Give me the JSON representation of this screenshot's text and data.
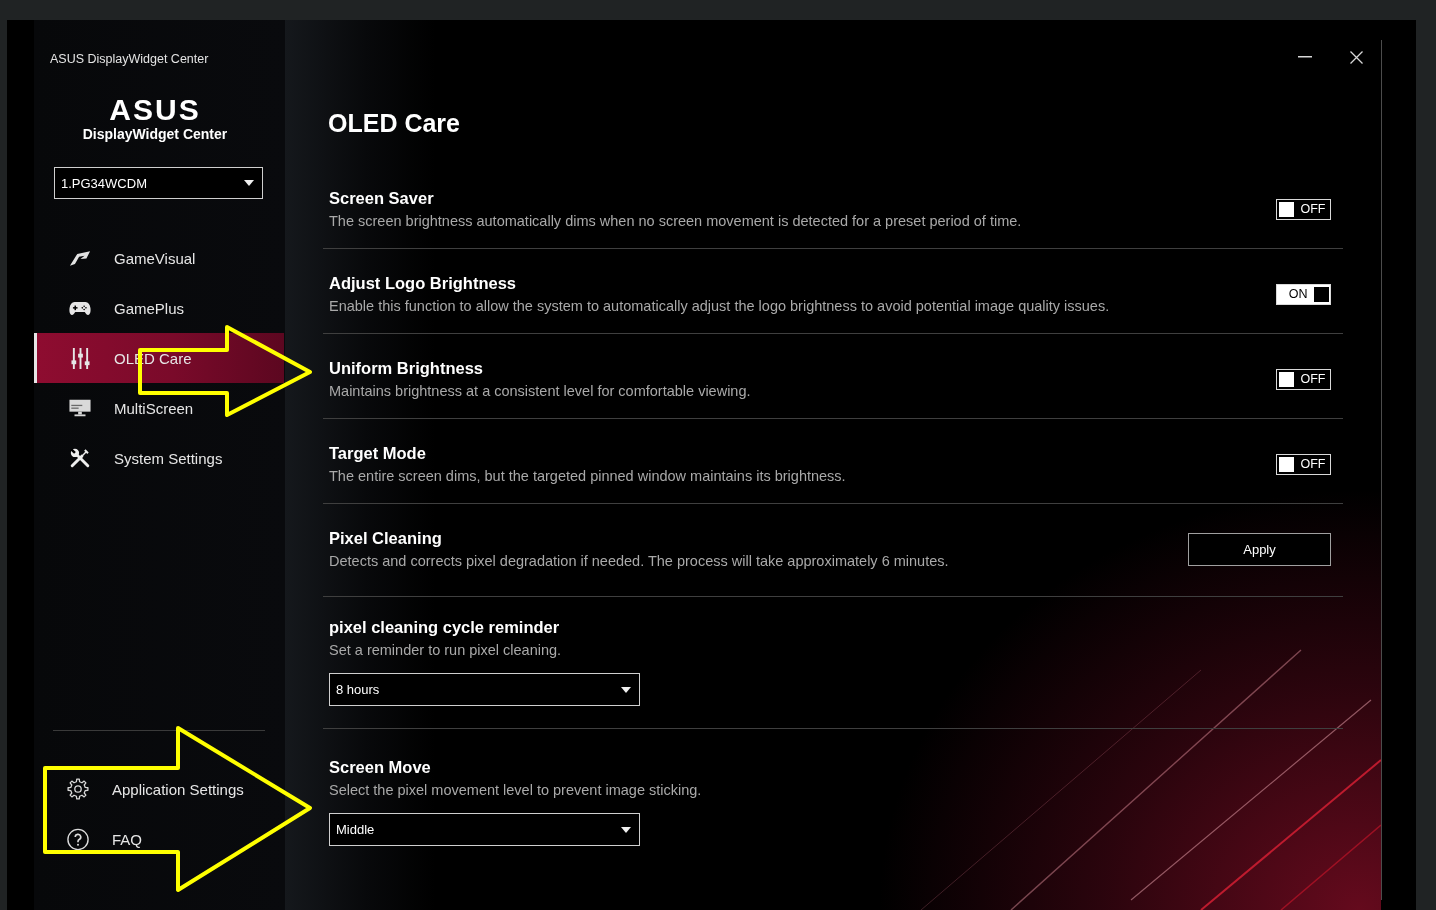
{
  "window": {
    "title": "ASUS DisplayWidget Center"
  },
  "brand": {
    "logo": "ASUS",
    "product": "DisplayWidget Center"
  },
  "monitor_select": {
    "value": "1.PG34WCDM"
  },
  "sidebar": {
    "items": [
      {
        "label": "GameVisual",
        "selected": false
      },
      {
        "label": "GamePlus",
        "selected": false
      },
      {
        "label": "OLED Care",
        "selected": true
      },
      {
        "label": "MultiScreen",
        "selected": false
      },
      {
        "label": "System Settings",
        "selected": false
      }
    ],
    "footer_items": [
      {
        "label": "Application Settings"
      },
      {
        "label": "FAQ"
      }
    ]
  },
  "page": {
    "title": "OLED Care",
    "settings": [
      {
        "kind": "toggle",
        "title": "Screen Saver",
        "description": "The screen brightness automatically dims when no screen movement is detected for a preset period of time.",
        "on": false,
        "toggle_label": "OFF"
      },
      {
        "kind": "toggle",
        "title": "Adjust Logo Brightness",
        "description": "Enable this function to allow the system to automatically adjust the logo brightness to avoid potential image quality issues.",
        "on": true,
        "toggle_label": "ON"
      },
      {
        "kind": "toggle",
        "title": "Uniform Brightness",
        "description": "Maintains brightness at a consistent level for comfortable viewing.",
        "on": false,
        "toggle_label": "OFF"
      },
      {
        "kind": "toggle",
        "title": "Target Mode",
        "description": "The entire screen dims, but the targeted pinned window maintains its brightness.",
        "on": false,
        "toggle_label": "OFF"
      },
      {
        "kind": "button",
        "title": "Pixel Cleaning",
        "description": "Detects and corrects pixel degradation if needed. The process will take approximately 6 minutes.",
        "button": "Apply"
      },
      {
        "kind": "dropdown",
        "title": "pixel cleaning cycle reminder",
        "description": "Set a reminder to run pixel cleaning.",
        "value": "8 hours"
      },
      {
        "kind": "dropdown",
        "title": "Screen Move",
        "description": "Select the pixel movement level to prevent image sticking.",
        "value": "Middle"
      }
    ]
  },
  "annotations": [
    {
      "kind": "arrow"
    },
    {
      "kind": "arrow"
    }
  ]
}
